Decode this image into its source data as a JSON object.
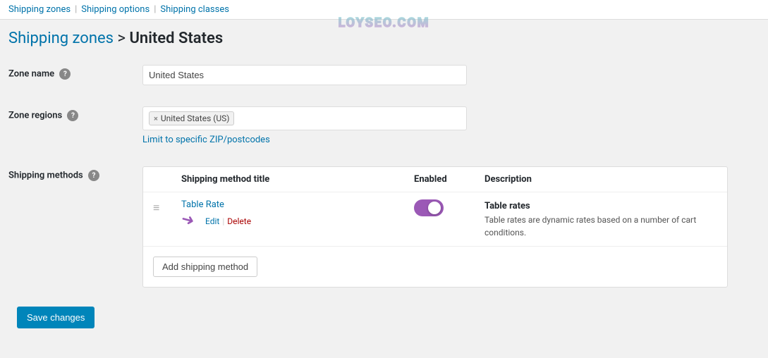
{
  "nav": {
    "shipping_zones_label": "Shipping zones",
    "shipping_options_label": "Shipping options",
    "shipping_classes_label": "Shipping classes"
  },
  "watermark": "LOYSEO.COM",
  "breadcrumb": {
    "parent_label": "Shipping zones",
    "separator": ">",
    "current_label": "United States"
  },
  "form": {
    "zone_name_label": "Zone name",
    "zone_name_value": "United States",
    "zone_name_placeholder": "Zone name",
    "zone_regions_label": "Zone regions",
    "zone_region_tag": "United States (US)",
    "limit_zip_label": "Limit to specific ZIP/postcodes",
    "shipping_methods_label": "Shipping methods",
    "col_method_title": "Shipping method title",
    "col_enabled": "Enabled",
    "col_description": "Description",
    "method_name": "Table Rate",
    "method_edit": "Edit",
    "method_delete": "Delete",
    "method_enabled": true,
    "method_desc_title": "Table rates",
    "method_desc_text": "Table rates are dynamic rates based on a number of cart conditions.",
    "add_method_label": "Add shipping method"
  },
  "save_label": "Save changes"
}
